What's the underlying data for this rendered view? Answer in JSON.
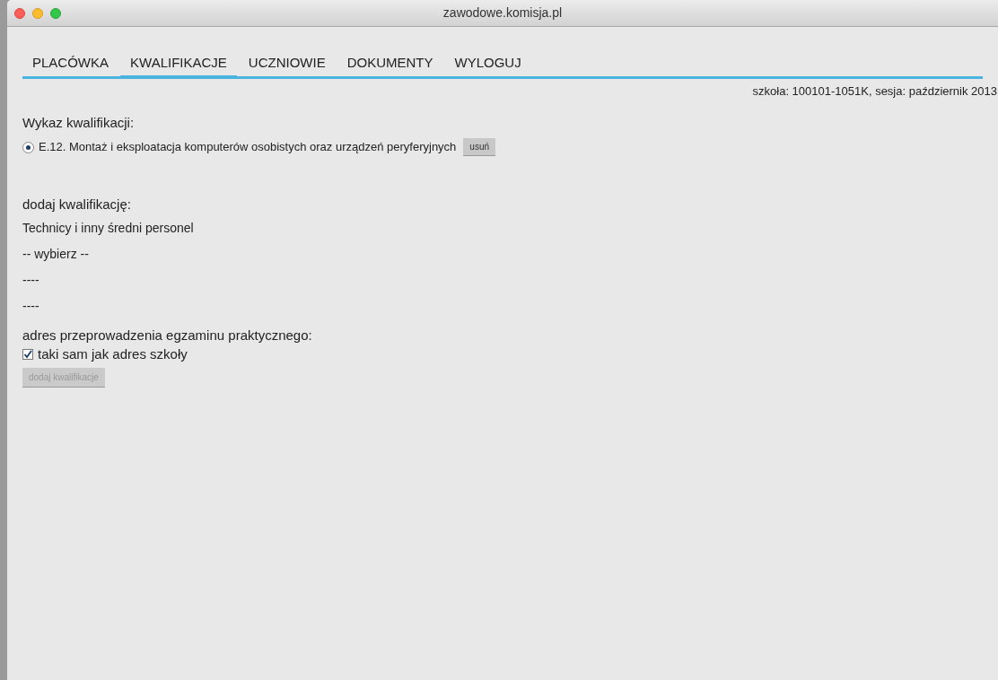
{
  "window": {
    "title": "zawodowe.komisja.pl"
  },
  "tabs": [
    {
      "label": "PLACÓWKA",
      "selected": false
    },
    {
      "label": "KWALIFIKACJE",
      "selected": true
    },
    {
      "label": "UCZNIOWIE",
      "selected": false
    },
    {
      "label": "DOKUMENTY",
      "selected": false
    },
    {
      "label": "WYLOGUJ",
      "selected": false
    }
  ],
  "school_info": "szkoła: 100101-1051K, sesja: październik 2013",
  "qualifications": {
    "heading": "Wykaz kwalifikacji:",
    "items": [
      {
        "label": "E.12. Montaż i eksploatacja komputerów osobistych oraz urządzeń peryferyjnych",
        "selected": true,
        "remove_button": "usuń"
      }
    ]
  },
  "add": {
    "heading": "dodaj kwalifikację:",
    "selects": [
      {
        "value": "Technicy i inny średni personel"
      },
      {
        "value": "-- wybierz --"
      },
      {
        "value": "----"
      },
      {
        "value": "----"
      }
    ],
    "address_heading": "adres przeprowadzenia egzaminu praktycznego:",
    "same_address": {
      "label": "taki sam jak adres szkoły",
      "checked": true
    },
    "submit": {
      "label": "dodaj kwalifikacje",
      "disabled": true
    }
  }
}
